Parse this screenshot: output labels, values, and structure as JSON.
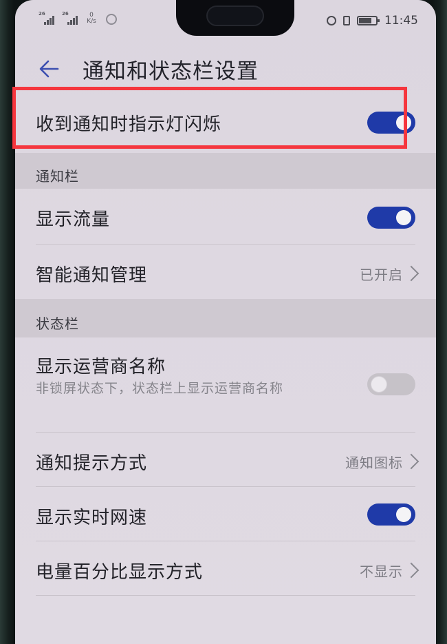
{
  "status_bar": {
    "sim1_tag": "26",
    "sim2_tag": "26",
    "net_speed_value": "0",
    "net_speed_unit": "K/s",
    "time": "11:45"
  },
  "header": {
    "title": "通知和状态栏设置"
  },
  "settings": {
    "notify_light": {
      "label": "收到通知时指示灯闪烁",
      "enabled": true
    },
    "notification_bar": {
      "section_title": "通知栏",
      "show_traffic": {
        "label": "显示流量",
        "enabled": true
      },
      "smart_notify": {
        "label": "智能通知管理",
        "value": "已开启"
      }
    },
    "status_bar_section": {
      "section_title": "状态栏",
      "show_carrier": {
        "label": "显示运营商名称",
        "description": "非锁屏状态下，状态栏上显示运营商名称",
        "enabled": false
      },
      "notify_style": {
        "label": "通知提示方式",
        "value": "通知图标"
      },
      "show_speed": {
        "label": "显示实时网速",
        "enabled": true
      },
      "battery_percent": {
        "label": "电量百分比显示方式",
        "value": "不显示"
      }
    }
  },
  "colors": {
    "toggle_on": "#1f3aa8",
    "highlight": "#f5363e"
  }
}
